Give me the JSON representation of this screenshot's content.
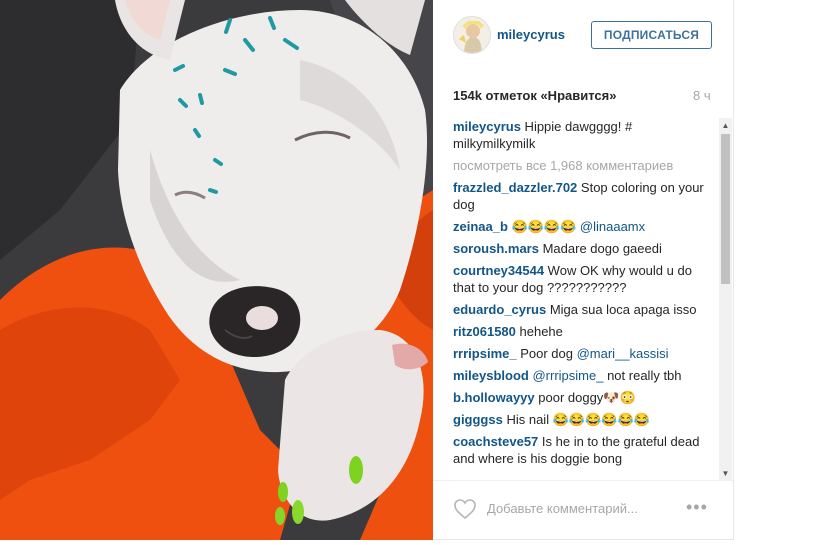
{
  "post": {
    "username": "mileycyrus",
    "follow_label": "ПОДПИСАТЬСЯ",
    "likes": "154k отметок «Нравится»",
    "time": "8 ч",
    "view_all": "посмотреть все 1,968 комментариев",
    "add_comment_placeholder": "Добавьте комментарий...",
    "more_label": "•••"
  },
  "comments": [
    {
      "user": "mileycyrus",
      "text": " Hippie dawgggg! # milkymilkymilk"
    },
    {
      "user": "frazzled_dazzler.702",
      "text": " Stop coloring on your dog"
    },
    {
      "user": "zeinaa_b",
      "text": " 😂😂😂😂 ",
      "mention": "@linaaamx"
    },
    {
      "user": "soroush.mars",
      "text": " Madare dogo gaeedi"
    },
    {
      "user": "courtney34544",
      "text": " Wow OK why would u do that to your dog ???????????"
    },
    {
      "user": "eduardo_cyrus",
      "text": " Miga sua loca apaga isso"
    },
    {
      "user": "ritz061580",
      "text": " hehehe"
    },
    {
      "user": "rrripsime_",
      "text": "  Poor dog ",
      "mention": "@mari__kassisi"
    },
    {
      "user": "mileysblood",
      "text": " ",
      "mention": "@rrripsime_",
      "text_after": " not really tbh"
    },
    {
      "user": "b.hollowayyy",
      "text": " poor doggy🐶😳"
    },
    {
      "user": "gigggss",
      "text": " His nail 😂😂😂😂😂😂"
    },
    {
      "user": "coachsteve57",
      "text": " Is he in to the grateful dead and where is his doggie bong"
    }
  ],
  "colors": {
    "link": "#125688",
    "follow": "#3f729b",
    "muted": "#a5a7aa"
  }
}
